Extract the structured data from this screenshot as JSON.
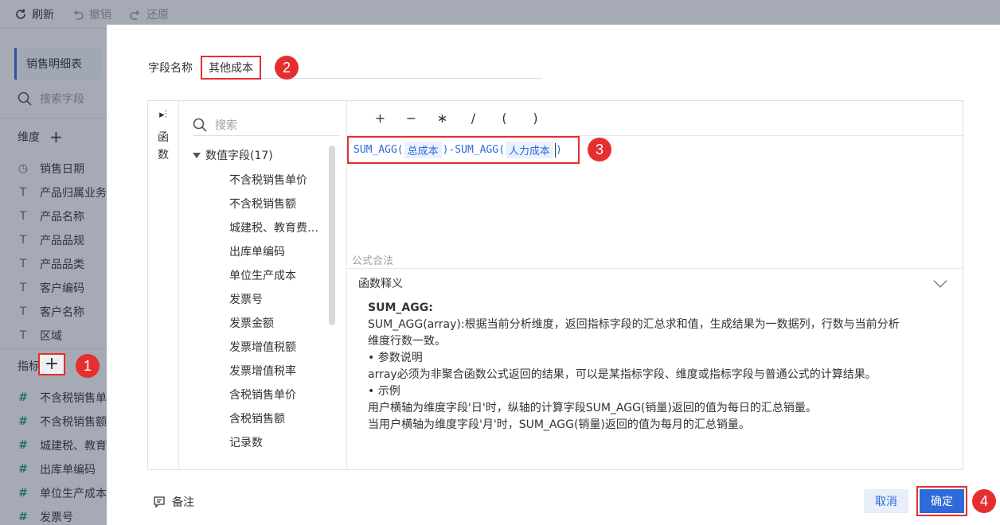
{
  "toolbar": {
    "refresh": "刷新",
    "undo": "撤销",
    "redo": "还原"
  },
  "sidebar": {
    "dataset_tab": "销售明细表",
    "search_placeholder": "搜索字段",
    "dimension_header": "维度",
    "dimensions": [
      {
        "type_icon": "calendar-icon",
        "label": "销售日期"
      },
      {
        "type_icon": "text-type-icon",
        "label": "产品归属业务"
      },
      {
        "type_icon": "text-type-icon",
        "label": "产品名称"
      },
      {
        "type_icon": "text-type-icon",
        "label": "产品品规"
      },
      {
        "type_icon": "text-type-icon",
        "label": "产品品类"
      },
      {
        "type_icon": "text-type-icon",
        "label": "客户编码"
      },
      {
        "type_icon": "text-type-icon",
        "label": "客户名称"
      },
      {
        "type_icon": "text-type-icon",
        "label": "区域"
      }
    ],
    "metric_header": "指标",
    "metrics": [
      {
        "type_icon": "number-type-icon",
        "label": "不含税销售单"
      },
      {
        "type_icon": "number-type-icon",
        "label": "不含税销售额"
      },
      {
        "type_icon": "number-type-icon",
        "label": "城建税、教育"
      },
      {
        "type_icon": "number-type-icon",
        "label": "出库单编码"
      },
      {
        "type_icon": "number-type-icon",
        "label": "单位生产成本"
      },
      {
        "type_icon": "number-type-icon",
        "label": "发票号"
      }
    ]
  },
  "dialog": {
    "field_name_label": "字段名称",
    "field_name_value": "其他成本",
    "function_rail_label": "函数",
    "field_search_placeholder": "搜索",
    "field_group": "数值字段(17)",
    "fields": [
      "不含税销售单价",
      "不含税销售额",
      "城建税、教育费…",
      "出库单编码",
      "单位生产成本",
      "发票号",
      "发票金额",
      "发票增值税额",
      "发票增值税率",
      "含税销售单价",
      "含税销售额",
      "记录数"
    ],
    "operators": [
      "+",
      "−",
      "∗",
      "/",
      "(",
      ")"
    ],
    "formula": {
      "part1": "SUM_AGG(",
      "field1": "总成本",
      "part2": ")-SUM_AGG(",
      "field2": "人力成本",
      "part3": ")"
    },
    "validity_text": "公式合法",
    "explain_header": "函数释义",
    "explain": {
      "title": "SUM_AGG:",
      "line1": "SUM_AGG(array):根据当前分析维度，返回指标字段的汇总求和值，生成结果为一数据列，行数与当前分析",
      "line2": "维度行数一致。",
      "line3": "• 参数说明",
      "line4": "array必须为非聚合函数公式返回的结果，可以是某指标字段、维度或指标字段与普通公式的计算结果。",
      "line5": "• 示例",
      "line6": "用户横轴为维度字段'日'时，纵轴的计算字段SUM_AGG(销量)返回的值为每日的汇总销量。",
      "line7": "当用户横轴为维度字段'月'时，SUM_AGG(销量)返回的值为每月的汇总销量。"
    },
    "notes_label": "备注",
    "cancel_label": "取消",
    "confirm_label": "确定"
  },
  "annotations": {
    "step1": "1",
    "step2": "2",
    "step3": "3",
    "step4": "4"
  },
  "colors": {
    "accent": "#2f6bd8",
    "highlight": "#e52e2e",
    "overlay": "#28344e"
  }
}
